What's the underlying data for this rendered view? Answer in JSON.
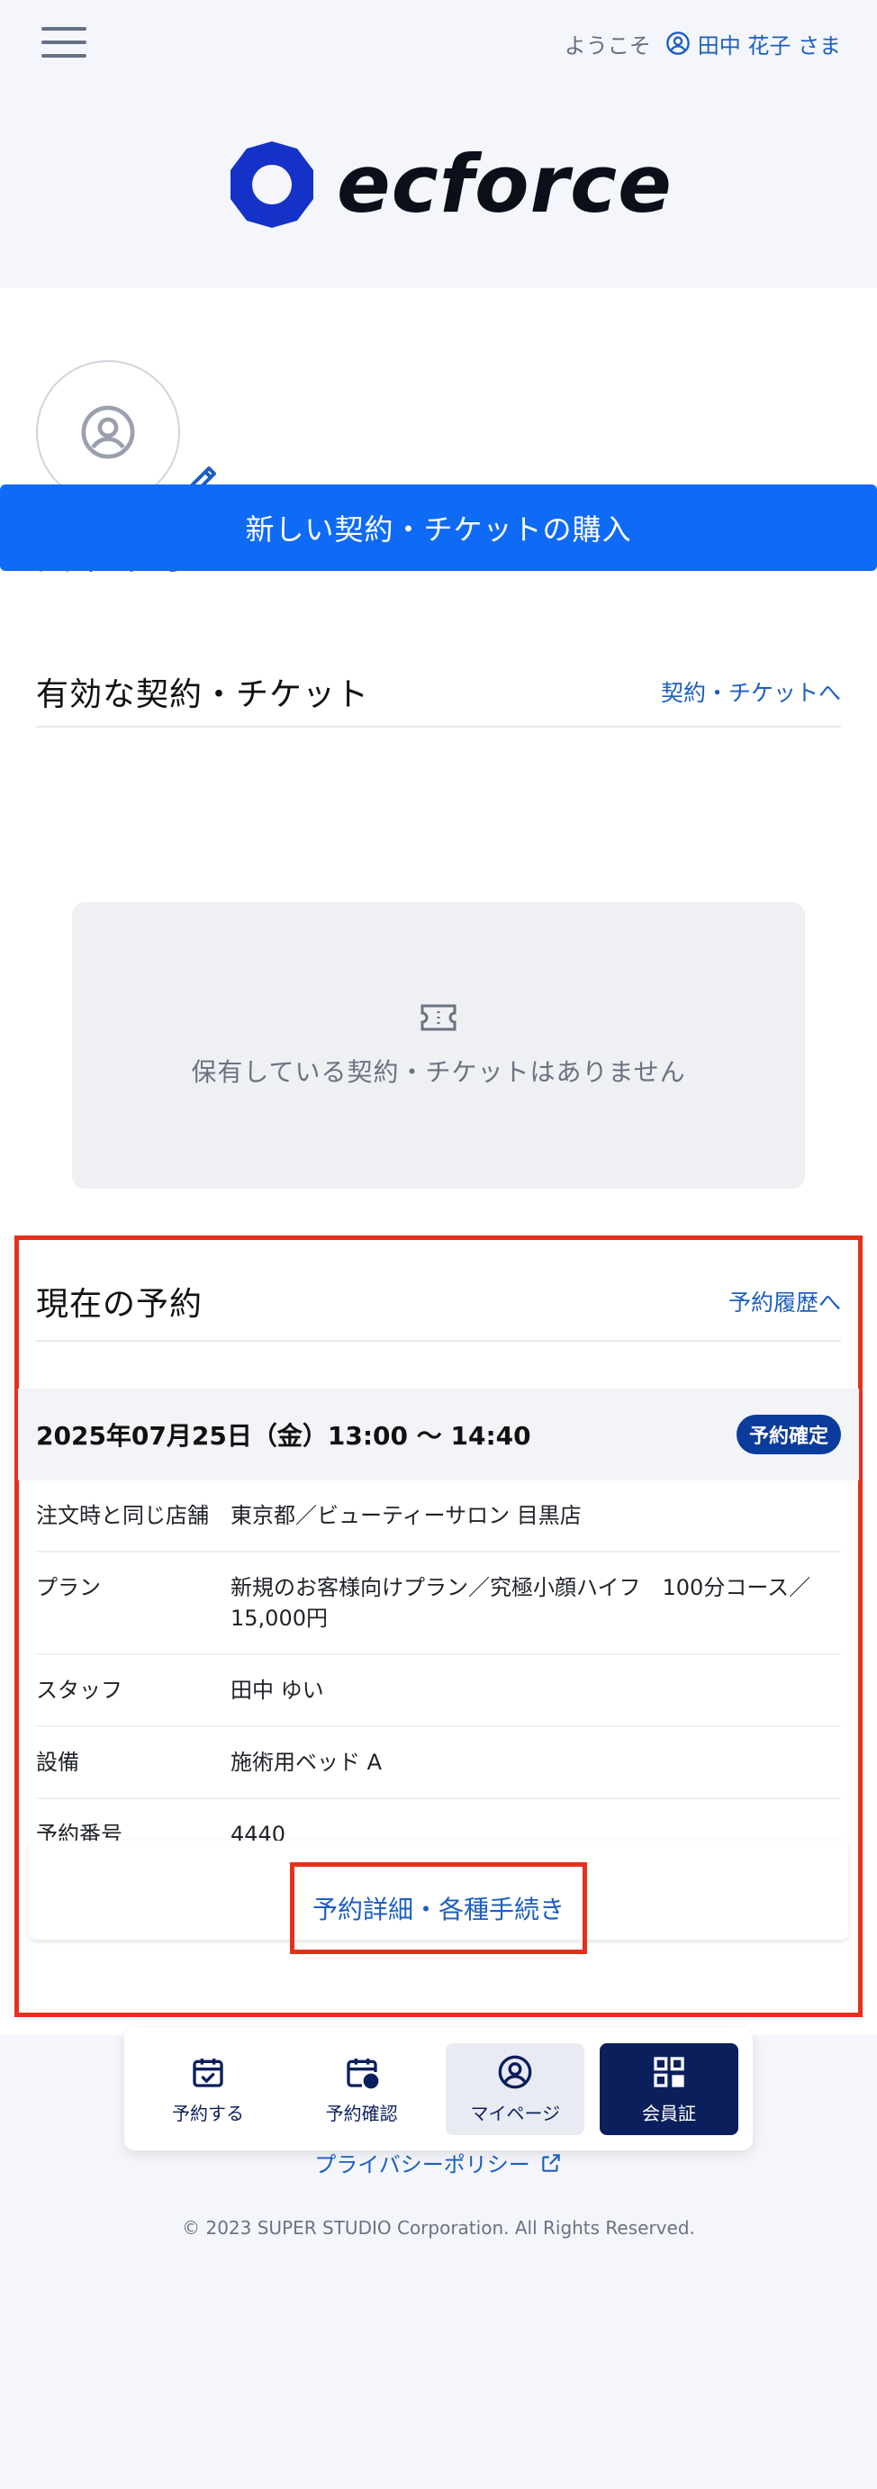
{
  "header": {
    "welcome": "ようこそ",
    "user_name": "田中 花子 さま",
    "logo_text": "ecforce"
  },
  "profile": {
    "title": "田中 花子 さま のマイページ"
  },
  "contracts": {
    "title": "有効な契約・チケット",
    "link": "契約・チケットへ",
    "buy_button": "新しい契約・チケットの購入",
    "empty_text": "保有している契約・チケットはありません"
  },
  "reservation": {
    "title": "現在の予約",
    "history_link": "予約履歴へ",
    "date": "2025年07月25日（金）13:00 〜 14:40",
    "status": "予約確定",
    "rows": [
      {
        "key": "注文時と同じ店舗",
        "value": "東京都／ビューティーサロン 目黒店"
      },
      {
        "key": "プラン",
        "value": "新規のお客様向けプラン／究極小顔ハイフ　100分コース／15,000円"
      },
      {
        "key": "スタッフ",
        "value": "田中 ゆい"
      },
      {
        "key": "設備",
        "value": "施術用ベッド A"
      },
      {
        "key": "予約番号",
        "value": "4440"
      }
    ],
    "detail_button": "予約詳細・各種手続き"
  },
  "bottom_nav": {
    "items": [
      {
        "label": "予約する",
        "icon": "calendar-check-icon"
      },
      {
        "label": "予約確認",
        "icon": "calendar-clock-icon"
      },
      {
        "label": "マイページ",
        "icon": "user-circle-icon"
      },
      {
        "label": "会員証",
        "icon": "qr-code-icon"
      }
    ]
  },
  "footer": {
    "privacy": "プライバシーポリシー",
    "copyright": "© 2023 SUPER STUDIO Corporation. All Rights Reserved."
  },
  "colors": {
    "accent": "#0f6bf6",
    "link": "#1d5fbf",
    "navy": "#0b1f5c",
    "highlight": "#e6301b"
  }
}
